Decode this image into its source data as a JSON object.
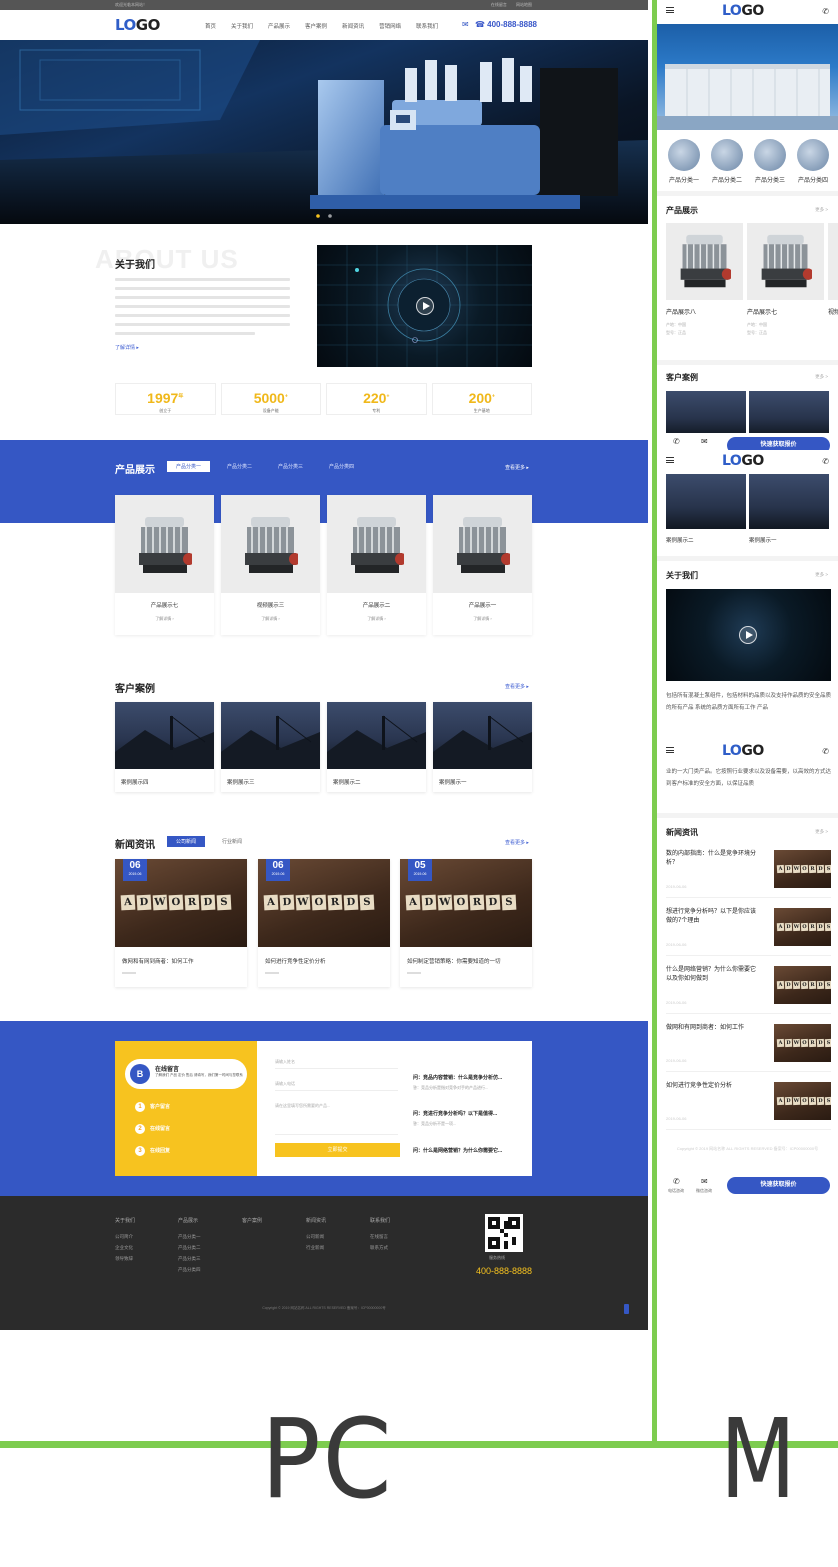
{
  "pc": {
    "topbar": {
      "welcome": "欢迎光临本网站！",
      "links": "在线留言 网站地图"
    },
    "logo": {
      "part1": "LO",
      "part2": "GO"
    },
    "nav": [
      "首页",
      "关于我们",
      "产品展示",
      "客户案例",
      "新闻资讯",
      "营销网络",
      "联系我们"
    ],
    "phone": "400-888-8888",
    "about": {
      "bg_title": "ABOUT US",
      "title": "关于我们",
      "more": "了解详情 ▸",
      "stats": [
        {
          "num": "1997",
          "unit": "年",
          "label": "创立于"
        },
        {
          "num": "5000",
          "unit": "+",
          "label": "设备产能"
        },
        {
          "num": "220",
          "unit": "+",
          "label": "专利"
        },
        {
          "num": "200",
          "unit": "+",
          "label": "生产基地"
        }
      ]
    },
    "products": {
      "title": "产品展示",
      "tabs": [
        "产品分类一",
        "产品分类二",
        "产品分类三",
        "产品分类四"
      ],
      "more": "查看更多 ▸",
      "items": [
        {
          "name": "产品展示七",
          "link": "了解详情"
        },
        {
          "name": "视频展示三",
          "link": "了解详情"
        },
        {
          "name": "产品展示二",
          "link": "了解详情"
        },
        {
          "name": "产品展示一",
          "link": "了解详情"
        }
      ]
    },
    "cases": {
      "title": "客户案例",
      "more": "查看更多 ▸",
      "items": [
        "案例展示四",
        "案例展示三",
        "案例展示二",
        "案例展示一"
      ]
    },
    "news": {
      "title": "新闻资讯",
      "tabs": [
        "公司新闻",
        "行业新闻"
      ],
      "more": "查看更多 ▸",
      "tile_word": [
        "A",
        "D",
        "W",
        "O",
        "R",
        "D",
        "S"
      ],
      "items": [
        {
          "day": "06",
          "ym": "2019-06",
          "title": "做网和有网到商者：如何工作"
        },
        {
          "day": "06",
          "ym": "2019-06",
          "title": "如何进行竞争性定价分析"
        },
        {
          "day": "05",
          "ym": "2019-06",
          "title": "如何制定营销策略：你需要知道的一切"
        }
      ]
    },
    "message": {
      "icon": "B",
      "title": "在线留言",
      "subtitle": "了解我们 产品 定价 售后 请填写，我们第一时间与您联系",
      "steps": [
        "客户留言",
        "在线留言",
        "在线回复"
      ],
      "fields": [
        "请输入姓名",
        "请输入电话",
        "请在这里填写您所需要的产品..."
      ],
      "submit": "立即提交",
      "qa": [
        {
          "q": "问：竞品内容营销：什么是竞争分析仿...",
          "a": "答：竞品分析是指对竞争对手的产品进行..."
        },
        {
          "q": "问：竞进行竞争分析吗？以下是值得...",
          "a": "答：竞品分析不是一项..."
        },
        {
          "q": "问：什么是网络营销？为什么你需要它...",
          "a": ""
        }
      ]
    },
    "footer": {
      "cols": [
        {
          "head": "关于我们",
          "items": [
            "公司简介",
            "企业文化",
            "领导致辞"
          ]
        },
        {
          "head": "产品展示",
          "items": [
            "产品分类一",
            "产品分类二",
            "产品分类三",
            "产品分类四"
          ]
        },
        {
          "head": "客户案例",
          "items": []
        },
        {
          "head": "新闻资讯",
          "items": [
            "公司新闻",
            "行业新闻"
          ]
        },
        {
          "head": "联系我们",
          "items": [
            "在线留言",
            "联系方式"
          ]
        }
      ],
      "phone_label": "服务热线",
      "phone": "400-888-8888",
      "copyright": "Copyright © 2019 网站名称 ALL RIGHTS RESERVED 备案号：ICP00000000号"
    }
  },
  "mobile": {
    "logo": {
      "part1": "LO",
      "part2": "GO"
    },
    "categories": [
      "产品分类一",
      "产品分类二",
      "产品分类三",
      "产品分类四"
    ],
    "products": {
      "title": "产品展示",
      "more": "更多 >",
      "items": [
        {
          "name": "产品展示八",
          "spec": "产地：中国",
          "code": "型号：正品"
        },
        {
          "name": "产品展示七",
          "spec": "产地：中国",
          "code": "型号：正品"
        },
        {
          "name": "视频",
          "spec": "",
          "code": ""
        }
      ]
    },
    "cases": {
      "title": "客户案例",
      "more": "更多 >",
      "items": [
        "案例展示二",
        "案例展示一"
      ]
    },
    "about": {
      "title": "关于我们",
      "more": "更多 >",
      "text1": "包括所有混凝土泵组件，包括材料的品质以及支持作品质的安全品质的所有产品 系统的品质方面所有工作 产品",
      "text2": "业的一大门类产品。它按照行业要求以及设备需要，以高效的方式达到客户标准的安全方面，以保证品质"
    },
    "news": {
      "title": "新闻资讯",
      "more": "更多 >",
      "items": [
        {
          "title": "数的内部指南：什么是竞争环境分析？",
          "date": "2019-06-06"
        },
        {
          "title": "想进行竞争分析吗？以下是你应该做的7个理由",
          "date": "2019-06-06"
        },
        {
          "title": "什么是网络营销？为什么你需要它以及你如何做到",
          "date": "2019-06-06"
        },
        {
          "title": "做网和有网到商者：如何工作",
          "date": "2019-06-06"
        },
        {
          "title": "如何进行竞争性定价分析",
          "date": "2019-06-06"
        }
      ]
    },
    "copyright": "Copyright © 2019 网站名称 ALL RIGHTS RESERVED 备案号：ICP00000000号",
    "bar": {
      "phone": "电话咨询",
      "wechat": "微信咨询",
      "cta": "快速获取报价"
    }
  },
  "labels": {
    "pc": "PC",
    "m": "M"
  },
  "colors": {
    "primary": "#3557c4",
    "accent": "#f7c31f",
    "divider": "#7dcc4f"
  }
}
